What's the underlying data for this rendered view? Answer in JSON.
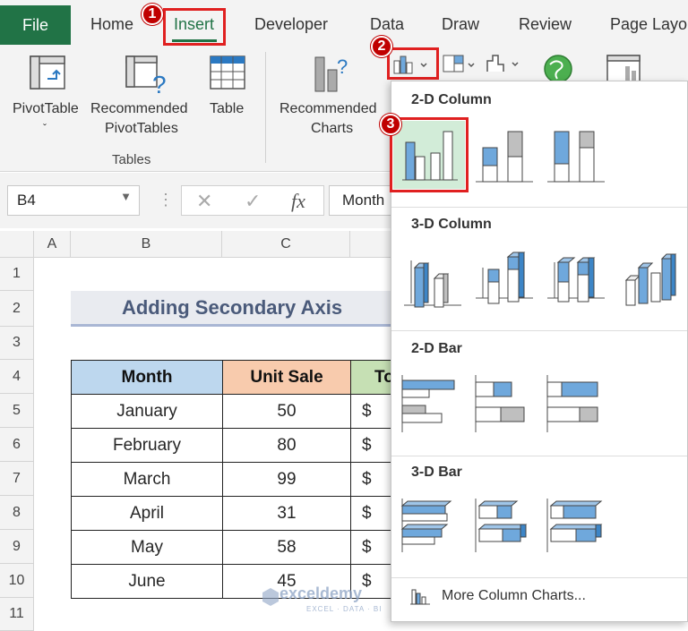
{
  "ribbon_tabs": {
    "file": "File",
    "home": "Home",
    "insert": "Insert",
    "developer": "Developer",
    "data": "Data",
    "draw": "Draw",
    "review": "Review",
    "page_layout": "Page Layo"
  },
  "ribbon": {
    "pivot_table": "PivotTable",
    "pivot_caret": "ˇ",
    "recommended_pivot_1": "Recommended",
    "recommended_pivot_2": "PivotTables",
    "table": "Table",
    "tables_group": "Tables",
    "recommended_charts_1": "Recommended",
    "recommended_charts_2": "Charts"
  },
  "steps": {
    "one": "1",
    "two": "2",
    "three": "3"
  },
  "formula_bar": {
    "name_box": "B4",
    "cancel": "✕",
    "enter": "✓",
    "fx": "fx",
    "formula": "Month"
  },
  "columns": [
    "A",
    "B",
    "C"
  ],
  "rows": [
    "1",
    "2",
    "3",
    "4",
    "5",
    "6",
    "7",
    "8",
    "9",
    "10",
    "11"
  ],
  "sheet": {
    "title": "Adding Secondary Axis",
    "headers": {
      "month": "Month",
      "unit_sale": "Unit Sale",
      "total": "Tot"
    },
    "data": [
      {
        "month": "January",
        "unit_sale": "50",
        "currency": "$"
      },
      {
        "month": "February",
        "unit_sale": "80",
        "currency": "$"
      },
      {
        "month": "March",
        "unit_sale": "99",
        "currency": "$"
      },
      {
        "month": "April",
        "unit_sale": "31",
        "currency": "$"
      },
      {
        "month": "May",
        "unit_sale": "58",
        "currency": "$"
      },
      {
        "month": "June",
        "unit_sale": "45",
        "currency": "$"
      }
    ]
  },
  "dropdown": {
    "col2d": "2-D Column",
    "col3d": "3-D Column",
    "bar2d": "2-D Bar",
    "bar3d": "3-D Bar",
    "more": "More Column Charts..."
  },
  "watermark": {
    "name": "exceldemy",
    "tagline": "EXCEL · DATA · BI"
  },
  "colors": {
    "excel_green": "#217346",
    "highlight_red": "#e02020",
    "month_header": "#bdd7ee",
    "unit_header": "#f8cbad",
    "total_header": "#c6e0b4",
    "chart_blue": "#6fa8dc",
    "chart_gray": "#bfbfbf"
  }
}
